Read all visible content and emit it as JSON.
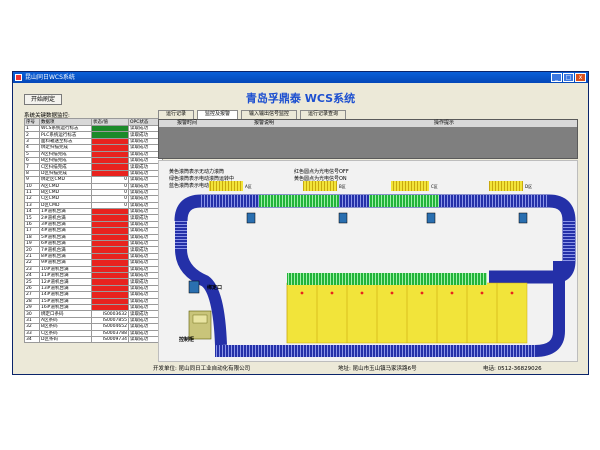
{
  "window": {
    "title": "昆山同日WCS系统",
    "min_glyph": "_",
    "max_glyph": "□",
    "close_glyph": "x"
  },
  "toolbar": {
    "start_label": "开始刷定"
  },
  "app_title": "青岛孚鼎泰 WCS系统",
  "monitor": {
    "label": "系统关键数据监控:",
    "columns": [
      "序号",
      "数据项",
      "状态/值",
      "OPC状态"
    ],
    "rows": [
      {
        "no": "1",
        "name": "WCS系统运行标志",
        "status": "",
        "color": "green",
        "opc": "读取成功"
      },
      {
        "no": "2",
        "name": "PLC系统运行标志",
        "status": "",
        "color": "green",
        "opc": "读取成功"
      },
      {
        "no": "3",
        "name": "面料箱送至标志",
        "status": "",
        "color": "red",
        "opc": "读取成功"
      },
      {
        "no": "4",
        "name": "绑定扫描完成",
        "status": "",
        "color": "red",
        "opc": "读取成功"
      },
      {
        "no": "5",
        "name": "A区扫描完成",
        "status": "",
        "color": "red",
        "opc": "读取成功"
      },
      {
        "no": "6",
        "name": "B区扫描完成",
        "status": "",
        "color": "red",
        "opc": "读取成功"
      },
      {
        "no": "7",
        "name": "C区扫描完成",
        "status": "",
        "color": "red",
        "opc": "读取成功"
      },
      {
        "no": "8",
        "name": "D区扫描完成",
        "status": "",
        "color": "red",
        "opc": "读取成功"
      },
      {
        "no": "9",
        "name": "绑定区CMD",
        "status": "0",
        "color": "",
        "opc": "读取成功"
      },
      {
        "no": "10",
        "name": "A区CMD",
        "status": "0",
        "color": "",
        "opc": "读取成功"
      },
      {
        "no": "11",
        "name": "B区CMD",
        "status": "0",
        "color": "",
        "opc": "读取成功"
      },
      {
        "no": "12",
        "name": "C区CMD",
        "status": "0",
        "color": "",
        "opc": "读取成功"
      },
      {
        "no": "13",
        "name": "D区CMD",
        "status": "0",
        "color": "",
        "opc": "读取成功"
      },
      {
        "no": "14",
        "name": "1#道机台满",
        "status": "",
        "color": "red",
        "opc": "读取成功"
      },
      {
        "no": "15",
        "name": "2#道机台满",
        "status": "",
        "color": "red",
        "opc": "读取成功"
      },
      {
        "no": "16",
        "name": "3#道机台满",
        "status": "",
        "color": "red",
        "opc": "读取成功"
      },
      {
        "no": "17",
        "name": "4#道机台满",
        "status": "",
        "color": "red",
        "opc": "读取成功"
      },
      {
        "no": "18",
        "name": "5#道机台满",
        "status": "",
        "color": "red",
        "opc": "读取成功"
      },
      {
        "no": "19",
        "name": "6#道机台满",
        "status": "",
        "color": "red",
        "opc": "读取成功"
      },
      {
        "no": "20",
        "name": "7#道机台满",
        "status": "",
        "color": "red",
        "opc": "读取成功"
      },
      {
        "no": "21",
        "name": "8#道机台满",
        "status": "",
        "color": "red",
        "opc": "读取成功"
      },
      {
        "no": "22",
        "name": "9#道机台满",
        "status": "",
        "color": "red",
        "opc": "读取成功"
      },
      {
        "no": "23",
        "name": "10#道机台满",
        "status": "",
        "color": "red",
        "opc": "读取成功"
      },
      {
        "no": "24",
        "name": "11#道机台满",
        "status": "",
        "color": "red",
        "opc": "读取成功"
      },
      {
        "no": "25",
        "name": "12#道机台满",
        "status": "",
        "color": "red",
        "opc": "读取成功"
      },
      {
        "no": "26",
        "name": "13#道机台满",
        "status": "",
        "color": "red",
        "opc": "读取成功"
      },
      {
        "no": "27",
        "name": "14#道机台满",
        "status": "",
        "color": "red",
        "opc": "读取成功"
      },
      {
        "no": "28",
        "name": "15#道机台满",
        "status": "",
        "color": "red",
        "opc": "读取成功"
      },
      {
        "no": "29",
        "name": "16#道机台满",
        "status": "",
        "color": "red",
        "opc": "读取成功"
      },
      {
        "no": "30",
        "name": "绑定口条码",
        "status": "IS0003632",
        "color": "",
        "opc": "读取成功"
      },
      {
        "no": "31",
        "name": "A区条码",
        "status": "IS0007855",
        "color": "",
        "opc": "读取成功"
      },
      {
        "no": "32",
        "name": "B区条码",
        "status": "IS0004652",
        "color": "",
        "opc": "读取成功"
      },
      {
        "no": "33",
        "name": "C区条码",
        "status": "IS0003788",
        "color": "",
        "opc": "读取成功"
      },
      {
        "no": "34",
        "name": "D区条码",
        "status": "IS0009734",
        "color": "",
        "opc": "读取成功"
      }
    ]
  },
  "tabs": [
    {
      "label": "运行记录"
    },
    {
      "label": "监控及报警"
    },
    {
      "label": "输入输出信号监控"
    },
    {
      "label": "运行记录查询"
    }
  ],
  "alarm": {
    "col_time": "报警时间",
    "col_desc": "报警说明",
    "col_action": "操作提示"
  },
  "legend": {
    "line1": "黄色滚筒表示无动力滚筒",
    "line2": "绿色滚筒表示电动滚筒运转中",
    "line3": "蓝色滚筒表示电动滚筒停止",
    "line4": "红色圆点为光电信号OFF",
    "line5": "黄色圆点为光电信号ON"
  },
  "scene": {
    "zone_a": "A区",
    "zone_b": "B区",
    "zone_c": "C区",
    "zone_d": "D区",
    "bind_port": "绑定口",
    "control_cabinet": "控制柜"
  },
  "footer": {
    "developer": "开发单位: 昆山同日工业自动化有限公司",
    "address": "地址: 昆山市玉山镇马家浜路6号",
    "phone": "电话: 0512-36829026"
  },
  "colors": {
    "conveyor_blue": "#2430a8",
    "conveyor_green": "#22b33a",
    "conveyor_yellow": "#f2e43a",
    "status_red": "#e8231e",
    "status_green": "#1b8a2a",
    "title_blue": "#1c4fd0"
  }
}
